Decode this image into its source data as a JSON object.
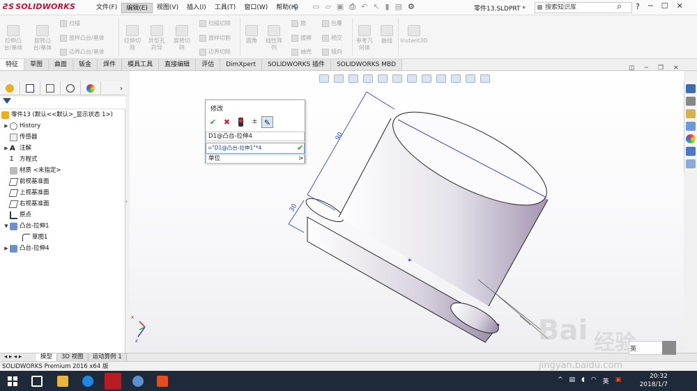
{
  "app": {
    "logo": "SOLIDWORKS",
    "doc_name": "零件13.SLDPRT *",
    "search_placeholder": "搜索知识库",
    "help": "?"
  },
  "menus": [
    "文件(F)",
    "编辑(E)",
    "视图(V)",
    "插入(I)",
    "工具(T)",
    "窗口(W)",
    "帮助(H)"
  ],
  "ribbon": {
    "big": [
      {
        "label": "拉伸凸\n台/基体"
      },
      {
        "label": "旋转凸\n台/基体"
      },
      {
        "label": "拉伸切\n除"
      },
      {
        "label": "异型孔\n向导"
      },
      {
        "label": "旋转切\n除"
      },
      {
        "label": "圆角"
      },
      {
        "label": "线性阵\n列"
      },
      {
        "label": "参考几\n何体"
      },
      {
        "label": "曲线"
      },
      {
        "label": "Instant3D"
      }
    ],
    "small": [
      {
        "label": "扫描"
      },
      {
        "label": "放样凸台/基体"
      },
      {
        "label": "边界凸台/基体"
      },
      {
        "label": "扫描切除"
      },
      {
        "label": "放样切割"
      },
      {
        "label": "边界切除"
      },
      {
        "label": "筋"
      },
      {
        "label": "拔模"
      },
      {
        "label": "抽壳"
      },
      {
        "label": "包覆"
      },
      {
        "label": "相交"
      },
      {
        "label": "镜向"
      }
    ]
  },
  "tabs": [
    "特征",
    "草图",
    "曲面",
    "钣金",
    "焊件",
    "模具工具",
    "直接编辑",
    "评估",
    "DimXpert",
    "SOLIDWORKS 插件",
    "SOLIDWORKS MBD"
  ],
  "tree": {
    "root": "零件13 (默认<<默认>_显示状态 1>)",
    "items": [
      {
        "label": "History",
        "arrow": "▶"
      },
      {
        "label": "传感器",
        "arrow": ""
      },
      {
        "label": "注解",
        "arrow": "▶"
      },
      {
        "label": "方程式",
        "arrow": ""
      },
      {
        "label": "材质 <未指定>",
        "arrow": ""
      },
      {
        "label": "前视基准面",
        "arrow": ""
      },
      {
        "label": "上视基准面",
        "arrow": ""
      },
      {
        "label": "右视基准面",
        "arrow": ""
      },
      {
        "label": "原点",
        "arrow": ""
      },
      {
        "label": "凸台-拉伸1",
        "arrow": "▼"
      },
      {
        "label": "草图1",
        "arrow": ""
      },
      {
        "label": "凸台-拉伸4",
        "arrow": "▶"
      }
    ]
  },
  "dialog": {
    "title": "修改",
    "name": "D1@凸台-拉伸4",
    "value": "=\"D1@凸台-拉伸1\"*4",
    "unit_label": "单位",
    "unit_arrow": ">"
  },
  "dimensions": {
    "d1": "90",
    "d2": "30"
  },
  "bottom_tabs": [
    "模型",
    "3D 视图",
    "运动算例 1"
  ],
  "status": "SOLIDWORKS Premium 2016 x64 版",
  "taskbar": {
    "time": "20:32",
    "date": "2018/1/7",
    "lang": "英"
  },
  "watermark": {
    "text1": "Bai",
    "text2": "经验",
    "text3": "jingyan.baidu.com",
    "badge": "英"
  },
  "colors": {
    "accent": "#2a5db0",
    "ok": "#23a323",
    "cancel": "#d22020",
    "dim": "#2848c8"
  }
}
